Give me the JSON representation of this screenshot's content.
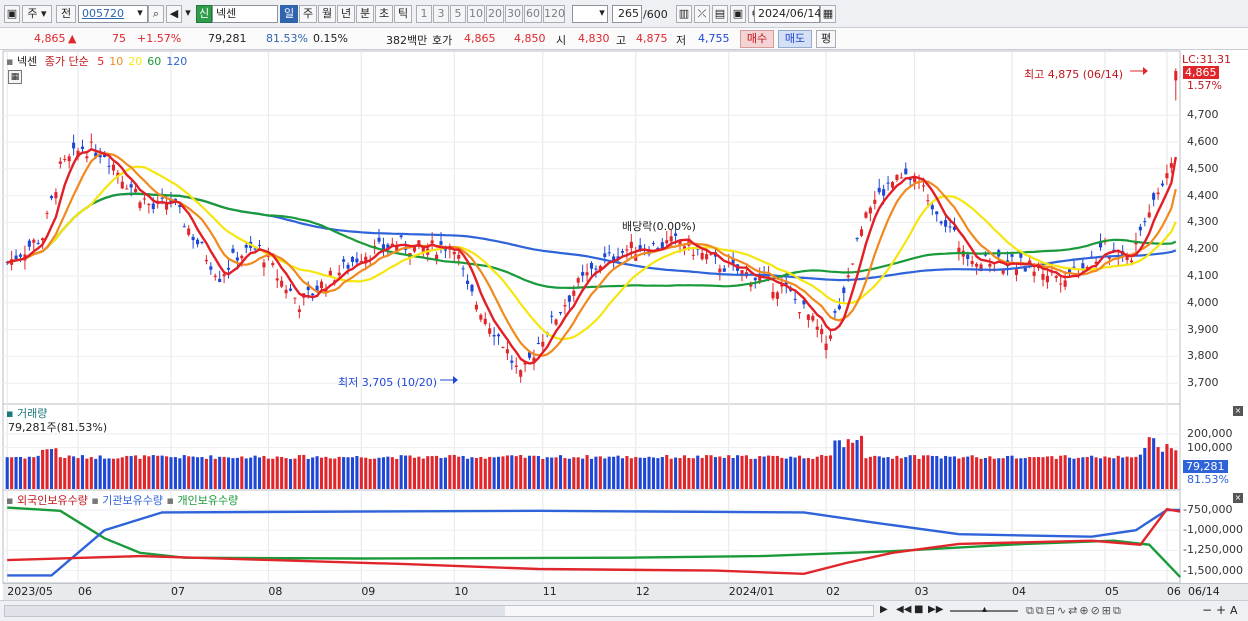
{
  "toolbar": {
    "market": "주",
    "prev": "전",
    "code": "005720",
    "badge": "신",
    "name": "넥센",
    "periods": [
      "일",
      "주",
      "월",
      "년",
      "분",
      "초",
      "틱"
    ],
    "active_period": "일",
    "intervals": [
      "1",
      "3",
      "5",
      "10",
      "20",
      "30",
      "60",
      "120"
    ],
    "count": "265",
    "count_total": "/600",
    "date": "2024/06/14"
  },
  "quote": {
    "price": "4,865",
    "change": "75",
    "change_pct": "+1.57%",
    "volume": "79,281",
    "vol_ratio": "81.53%",
    "turnover": "0.15%",
    "amount": "382백만",
    "bid_label": "호가",
    "bid1": "4,865",
    "bid2": "4,850",
    "open_label": "시",
    "open": "4,830",
    "high_label": "고",
    "high": "4,875",
    "low_label": "저",
    "low": "4,755",
    "buy": "매수",
    "sell": "매도",
    "eval": "평"
  },
  "price_pane": {
    "title": "넥센",
    "ma_label": "종가 단순",
    "ma_periods": [
      "5",
      "10",
      "20",
      "60",
      "120"
    ],
    "lc": "LC:31.31",
    "current": "4,865",
    "current_pct": "1.57%",
    "high_note": "최고 4,875 (06/14)",
    "low_note": "최저 3,705 (10/20)",
    "dividend_note": "배당락(0.00%)",
    "y_ticks": [
      "4,700",
      "4,600",
      "4,500",
      "4,400",
      "4,300",
      "4,200",
      "4,100",
      "4,000",
      "3,900",
      "3,800",
      "3,700"
    ]
  },
  "volume_pane": {
    "title": "거래량",
    "value_label": "79,281주(81.53%)",
    "y_ticks": [
      "200,000",
      "100,000"
    ],
    "current": "79,281",
    "current_pct": "81.53%"
  },
  "holdings_pane": {
    "legend": [
      "외국인보유수량",
      "기관보유수량",
      "개인보유수량"
    ],
    "y_ticks": [
      "-750,000",
      "-1,000,000",
      "-1,250,000",
      "-1,500,000"
    ]
  },
  "x_axis": {
    "labels": [
      "2023/05",
      "06",
      "07",
      "08",
      "09",
      "10",
      "11",
      "12",
      "2024/01",
      "02",
      "03",
      "04",
      "05",
      "06"
    ],
    "right_label": "06/14"
  },
  "colors": {
    "up": "#e0262b",
    "down": "#1f47d6",
    "ma5": "#e21f27",
    "ma10": "#f08a1e",
    "ma20": "#f5e60f",
    "ma60": "#1a9a3a",
    "ma120": "#2e63d9",
    "accent": "#2f65ad"
  }
}
